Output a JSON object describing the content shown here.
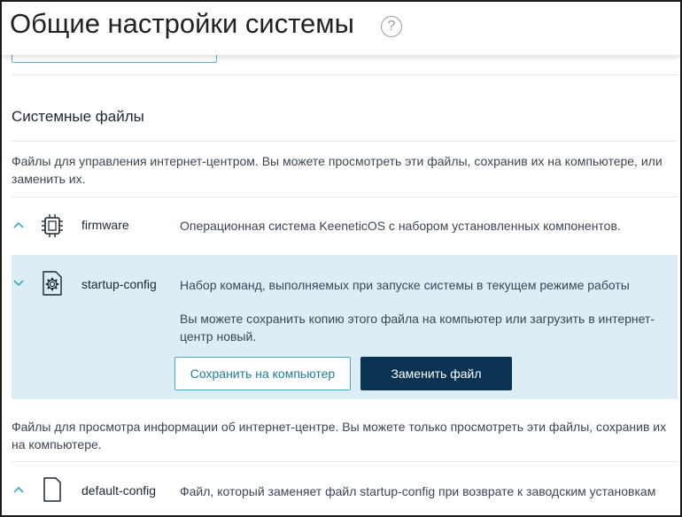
{
  "header": {
    "title": "Общие настройки системы",
    "help_glyph": "?"
  },
  "section": {
    "title": "Системные файлы",
    "manage_description": "Файлы для управления интернет-центром. Вы можете просмотреть эти файлы, сохранив их на компьютере, или заменить их.",
    "view_description": "Файлы для просмотра информации об интернет-центре. Вы можете только просмотреть эти файлы, сохранив их на компьютере."
  },
  "files": [
    {
      "name": "firmware",
      "icon": "chip-icon",
      "description": "Операционная система KeeneticOS с набором установленных компонентов."
    },
    {
      "name": "startup-config",
      "icon": "gear-file-icon",
      "description": "Набор команд, выполняемых при запуске системы в текущем режиме работы",
      "details": "Вы можете сохранить копию этого файла на компьютер или загрузить в интернет-центр новый.",
      "save_label": "Сохранить на компьютер",
      "replace_label": "Заменить файл"
    },
    {
      "name": "default-config",
      "icon": "file-icon",
      "description": "Файл, который заменяет файл startup-config при возврате к заводским установкам"
    }
  ],
  "colors": {
    "accent": "#47aac4",
    "primary_button": "#0a3252",
    "expanded_row": "#dbeef5"
  }
}
